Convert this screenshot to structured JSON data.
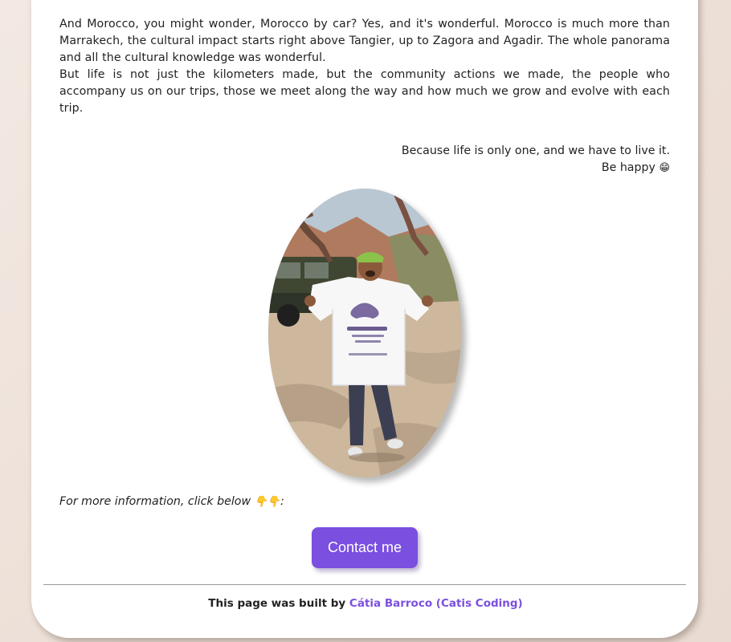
{
  "content": {
    "paragraph_1": "And Morocco, you might wonder, Morocco by car? Yes, and it's wonderful. Morocco is much more than Marrakech, the cultural impact starts right above Tangier, up to Zagora and Agadir. The whole panorama and all the cultural knowledge was wonderful.",
    "paragraph_2": "But life is not just the kilometers made, but the community actions we made, the people who accompany us on our trips, those we meet along the way and how much we grow and evolve with each trip.",
    "quote_line_1": "Because life is only one, and we have to live it.",
    "quote_line_2": "Be happy",
    "quote_emoji": "😁",
    "more_info_text": "For more information, click below",
    "more_info_emoji": "👇👇",
    "more_info_suffix": ":"
  },
  "photo": {
    "subject": "person holding white VISEU ABRAÇA t-shirt in Morocco",
    "shirt_text": "VISEU ABRAÇA"
  },
  "contact_button": {
    "label": "Contact me"
  },
  "footer": {
    "prefix": "This page was built by",
    "author_link": "Cátia Barroco (Catis Coding)"
  },
  "colors": {
    "accent": "#7b4fe0",
    "background": "#efe3dc",
    "card": "#ffffff",
    "text": "#222222"
  }
}
